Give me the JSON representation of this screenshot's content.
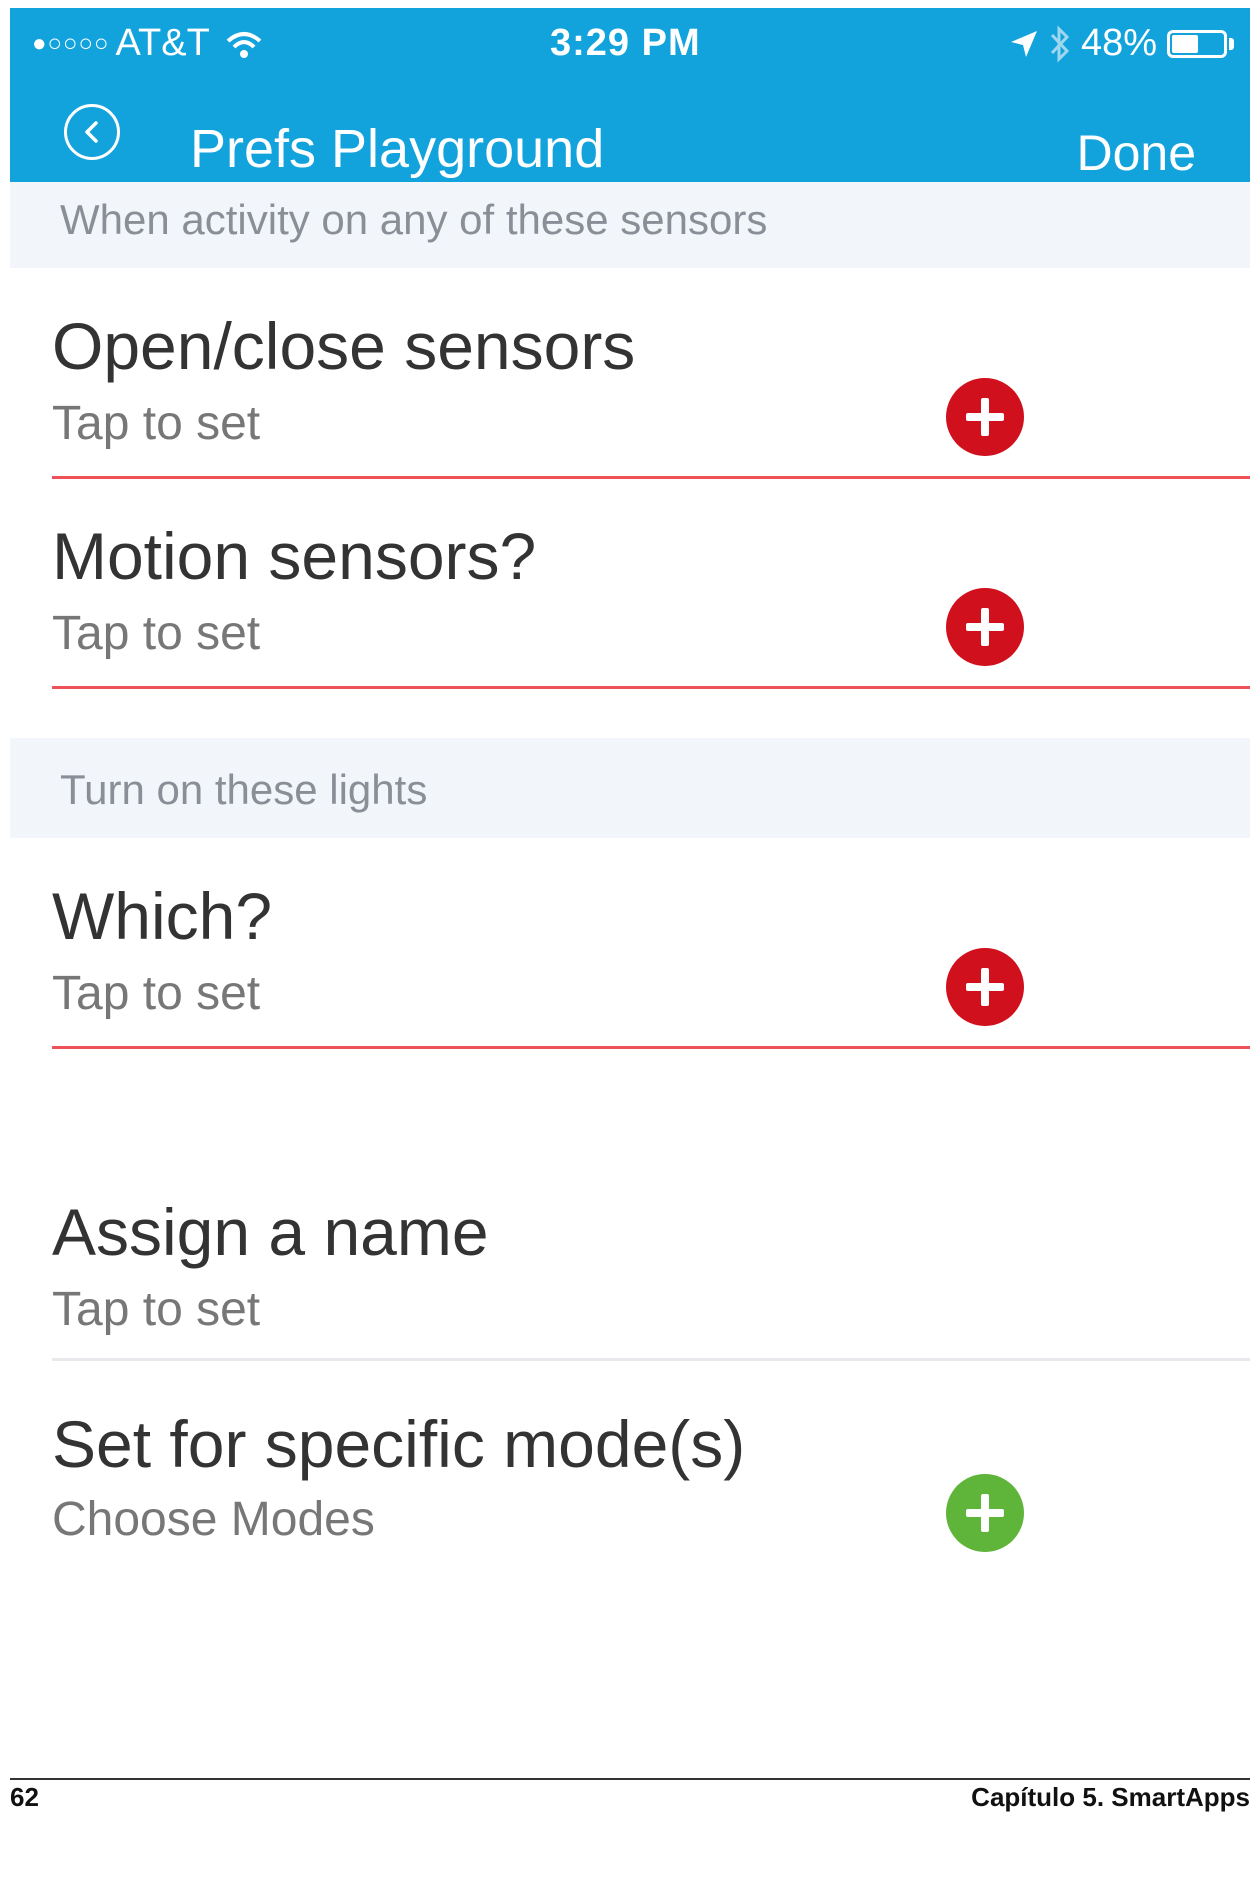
{
  "status_bar": {
    "carrier": "AT&T",
    "signal_dots": "●○○○○",
    "time": "3:29 PM",
    "battery": "48%",
    "battery_level": 0.48,
    "icons": [
      "wifi-icon",
      "location-arrow-icon",
      "bluetooth-icon",
      "battery-icon"
    ]
  },
  "nav": {
    "back_icon": "back-circle-icon",
    "title": "Prefs Playground",
    "done_label": "Done"
  },
  "sections": [
    {
      "header": "When activity on any of these sensors",
      "rows": [
        {
          "title": "Open/close sensors",
          "subtitle": "Tap to set",
          "required": true
        },
        {
          "title": "Motion sensors?",
          "subtitle": "Tap to set",
          "required": true
        }
      ]
    },
    {
      "header": "Turn on these lights",
      "rows": [
        {
          "title": "Which?",
          "subtitle": "Tap to set",
          "required": true
        }
      ]
    },
    {
      "header": "",
      "rows": [
        {
          "title": "Assign a name",
          "subtitle": "Tap to set",
          "required": false
        },
        {
          "title": "Set for specific mode(s)",
          "subtitle": "Choose Modes",
          "required": false
        }
      ]
    }
  ],
  "footer": {
    "page_number": "62",
    "chapter": "Capítulo 5. SmartApps"
  },
  "colors": {
    "nav_bar": "#12a3dd",
    "required_plus": "#d0101c",
    "optional_plus": "#5fb43a",
    "required_underline": "#f05057",
    "section_header_bg": "#f2f6fb"
  }
}
